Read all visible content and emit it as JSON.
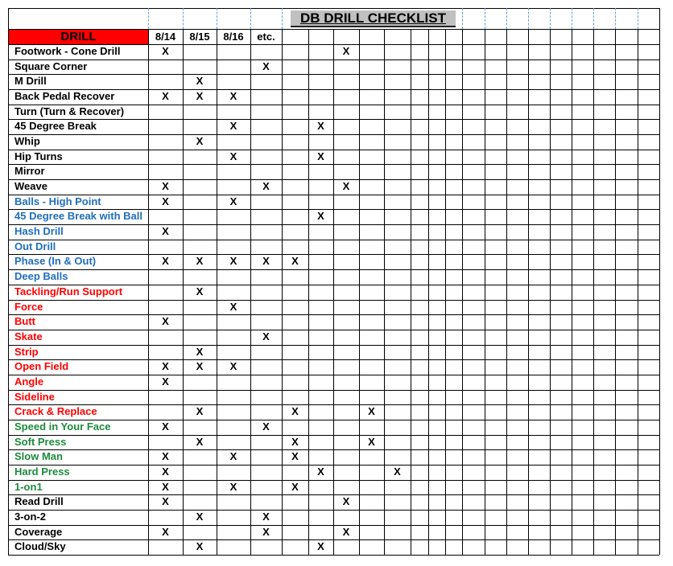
{
  "title": "DB DRILL CHECKLIST",
  "header": {
    "drill_label": "DRILL",
    "columns": [
      "8/14",
      "8/15",
      "8/16",
      "etc.",
      "",
      "",
      "",
      "",
      "",
      "",
      "",
      "",
      "",
      "",
      "",
      "",
      "",
      "",
      "",
      "",
      ""
    ]
  },
  "colors": {
    "header_red": "#ff0000",
    "title_bg": "#c0c0c0",
    "black": "#000000",
    "blue": "#1f6ebd",
    "red": "#ff0000",
    "green": "#1e8a3c"
  },
  "mark_symbol": "X",
  "drills": [
    {
      "name": "Footwork - Cone Drill",
      "color": "black",
      "marks": [
        0,
        6
      ]
    },
    {
      "name": "Square Corner",
      "color": "black",
      "marks": [
        3
      ]
    },
    {
      "name": "M Drill",
      "color": "black",
      "marks": [
        1
      ]
    },
    {
      "name": "Back Pedal Recover",
      "color": "black",
      "marks": [
        0,
        1,
        2
      ]
    },
    {
      "name": "Turn (Turn & Recover)",
      "color": "black",
      "marks": []
    },
    {
      "name": "45 Degree Break",
      "color": "black",
      "marks": [
        2,
        5
      ]
    },
    {
      "name": "Whip",
      "color": "black",
      "marks": [
        1
      ]
    },
    {
      "name": "Hip Turns",
      "color": "black",
      "marks": [
        2,
        5
      ]
    },
    {
      "name": "Mirror",
      "color": "black",
      "marks": []
    },
    {
      "name": "Weave",
      "color": "black",
      "marks": [
        0,
        3,
        6
      ]
    },
    {
      "name": "Balls - High Point",
      "color": "blue",
      "marks": [
        0,
        2
      ]
    },
    {
      "name": "45 Degree Break with Ball",
      "color": "blue",
      "marks": [
        5
      ]
    },
    {
      "name": "Hash Drill",
      "color": "blue",
      "marks": [
        0
      ]
    },
    {
      "name": "Out Drill",
      "color": "blue",
      "marks": []
    },
    {
      "name": "Phase (In & Out)",
      "color": "blue",
      "marks": [
        0,
        1,
        2,
        3,
        4
      ]
    },
    {
      "name": "Deep Balls",
      "color": "blue",
      "marks": []
    },
    {
      "name": "Tackling/Run Support",
      "color": "red",
      "marks": [
        1
      ]
    },
    {
      "name": "Force",
      "color": "red",
      "marks": [
        2
      ]
    },
    {
      "name": "Butt",
      "color": "red",
      "marks": [
        0
      ]
    },
    {
      "name": "Skate",
      "color": "red",
      "marks": [
        3
      ]
    },
    {
      "name": "Strip",
      "color": "red",
      "marks": [
        1
      ]
    },
    {
      "name": "Open Field",
      "color": "red",
      "marks": [
        0,
        1,
        2
      ]
    },
    {
      "name": "Angle",
      "color": "red",
      "marks": [
        0
      ]
    },
    {
      "name": "Sideline",
      "color": "red",
      "marks": []
    },
    {
      "name": "Crack & Replace",
      "color": "red",
      "marks": [
        1,
        4,
        7
      ]
    },
    {
      "name": "Speed in Your Face",
      "color": "green",
      "marks": [
        0,
        3
      ]
    },
    {
      "name": "Soft Press",
      "color": "green",
      "marks": [
        1,
        4,
        7
      ]
    },
    {
      "name": "Slow Man",
      "color": "green",
      "marks": [
        0,
        2,
        4
      ]
    },
    {
      "name": "Hard Press",
      "color": "green",
      "marks": [
        0,
        5,
        8
      ]
    },
    {
      "name": "1-on1",
      "color": "green",
      "marks": [
        0,
        2,
        4
      ]
    },
    {
      "name": "Read Drill",
      "color": "black",
      "marks": [
        0,
        6
      ]
    },
    {
      "name": "3-on-2",
      "color": "black",
      "marks": [
        1,
        3
      ]
    },
    {
      "name": "Coverage",
      "color": "black",
      "marks": [
        0,
        3,
        6
      ]
    },
    {
      "name": "Cloud/Sky",
      "color": "black",
      "marks": [
        1,
        5
      ]
    }
  ]
}
